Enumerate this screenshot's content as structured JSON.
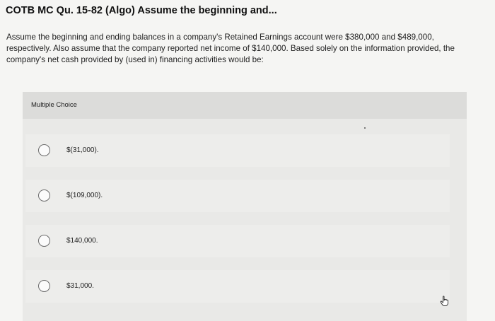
{
  "question": {
    "title": "COTB MC Qu. 15-82 (Algo) Assume the beginning and...",
    "text": "Assume the beginning and ending balances in a company's Retained Earnings account were $380,000 and $489,000, respectively. Also assume that the company reported net income of $140,000. Based solely on the information provided, the company's net cash provided by (used in) financing activities would be:"
  },
  "choices": {
    "label": "Multiple Choice",
    "options": [
      {
        "text": "$(31,000)."
      },
      {
        "text": "$(109,000)."
      },
      {
        "text": "$140,000."
      },
      {
        "text": "$31,000."
      }
    ]
  },
  "icons": {
    "cursor": "hand-pointer-icon"
  }
}
